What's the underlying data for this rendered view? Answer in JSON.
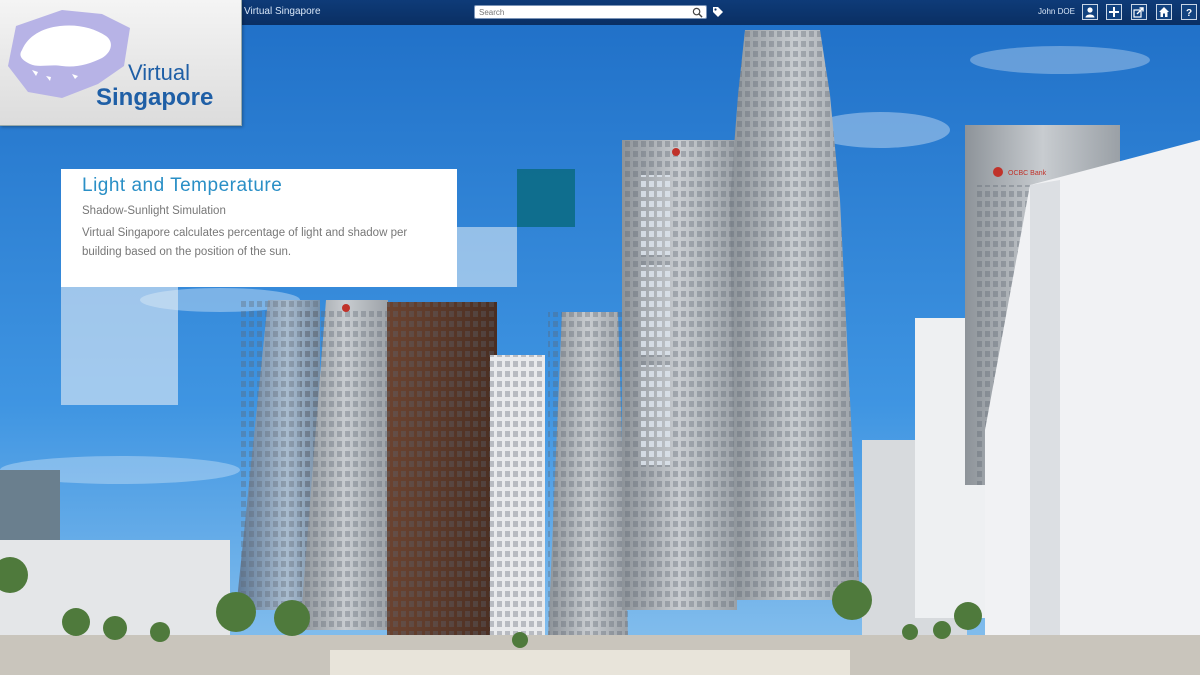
{
  "header": {
    "app_title": "Virtual Singapore",
    "search_placeholder": "Search",
    "user_name": "John DOE"
  },
  "toolbar": {
    "buttons": [
      {
        "icon": "user-icon"
      },
      {
        "icon": "plus-icon"
      },
      {
        "icon": "share-icon"
      },
      {
        "icon": "home-icon"
      },
      {
        "icon": "help-icon"
      }
    ]
  },
  "logo": {
    "line1": "Virtual",
    "line2": "Singapore"
  },
  "info": {
    "title": "Light and Temperature",
    "subtitle": "Shadow-Sunlight Simulation",
    "body": "Virtual Singapore calculates percentage of light and shadow per building based on the position of the sun."
  },
  "scene": {
    "building_sign": "OCBC Bank"
  },
  "colors": {
    "topbar": "#0a2f63",
    "accent": "#2a8fc6",
    "logo_text": "#1f5fa6",
    "deco_teal": "#0e6d8a"
  }
}
